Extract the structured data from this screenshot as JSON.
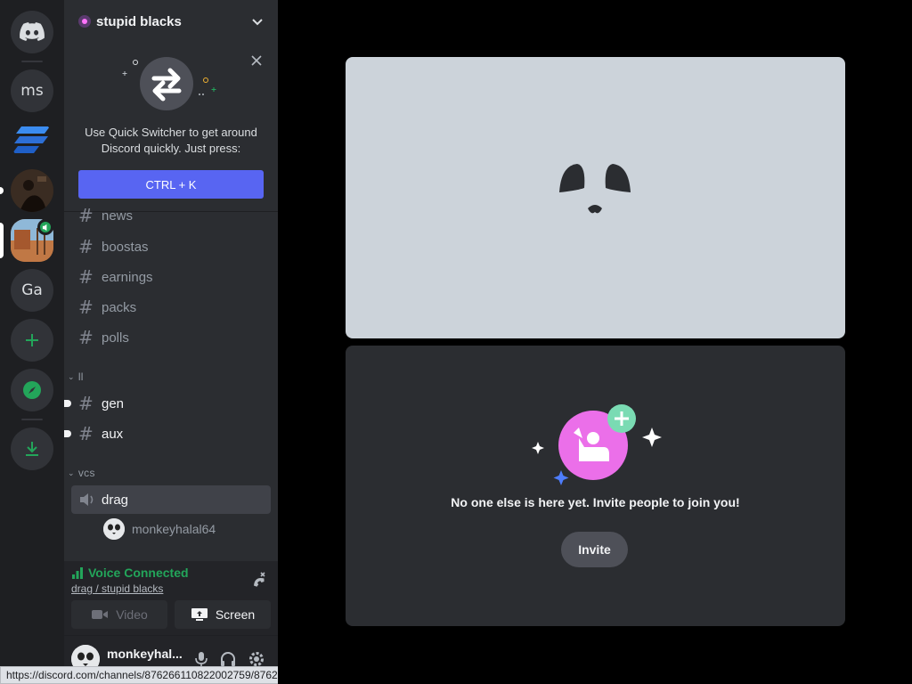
{
  "rail": {
    "servers": [
      {
        "label": "ms"
      },
      {
        "label": "Ga"
      }
    ],
    "add_label": "+"
  },
  "guild": {
    "name": "stupid blacks"
  },
  "quick_switcher": {
    "text": "Use Quick Switcher to get around Discord quickly. Just press:",
    "shortcut": "CTRL + K"
  },
  "channels": {
    "top": [
      {
        "name": "news"
      },
      {
        "name": "boostas"
      },
      {
        "name": "earnings"
      },
      {
        "name": "packs"
      },
      {
        "name": "polls"
      }
    ],
    "category_ll": {
      "name": "ll",
      "items": [
        {
          "name": "gen"
        },
        {
          "name": "aux"
        }
      ]
    },
    "category_vcs": {
      "name": "vcs",
      "voice_channel": "drag",
      "member": "monkeyhalal64"
    }
  },
  "voice_panel": {
    "status": "Voice Connected",
    "subtitle": "drag / stupid blacks",
    "video_label": "Video",
    "screen_label": "Screen"
  },
  "user_panel": {
    "username": "monkeyhal..."
  },
  "status_url": "https://discord.com/channels/876266110822002759/876272315237797889",
  "stage": {
    "empty_message": "No one else is here yet. Invite people to join you!",
    "invite_label": "Invite"
  },
  "colors": {
    "accent": "#5865f2",
    "voice_green": "#23a55a",
    "invite_pink": "#eb6fe9",
    "invite_teal": "#7adbb3"
  }
}
